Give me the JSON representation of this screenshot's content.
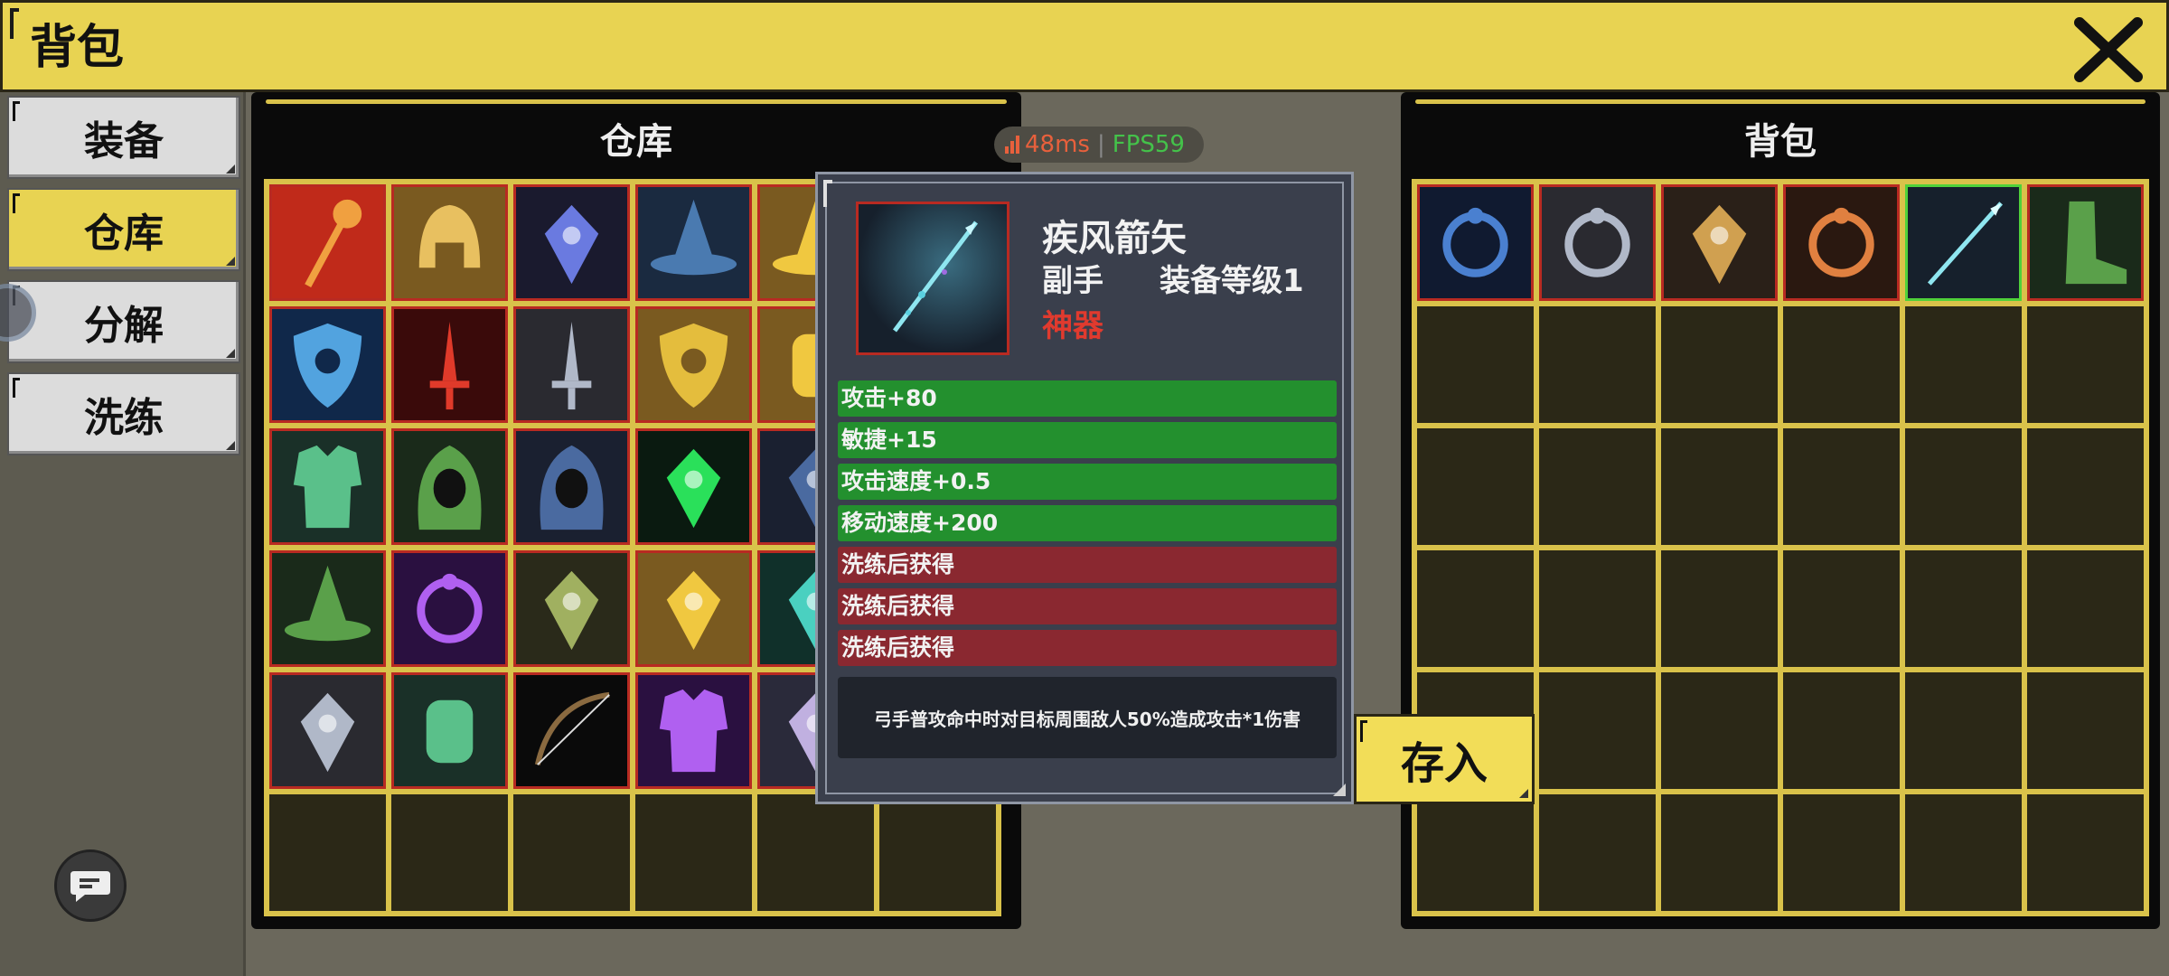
{
  "header": {
    "title": "背包"
  },
  "tabs": [
    {
      "label": "装备"
    },
    {
      "label": "仓库"
    },
    {
      "label": "分解"
    },
    {
      "label": "洗练"
    }
  ],
  "network": {
    "ping": "48ms",
    "fps": "FPS59"
  },
  "warehouse": {
    "title": "仓库"
  },
  "bag": {
    "title": "背包"
  },
  "tooltip": {
    "name": "疾风箭矢",
    "slot": "副手",
    "level": "装备等级1",
    "rarity": "神器",
    "stats": [
      {
        "text": "攻击+80",
        "kind": "green"
      },
      {
        "text": "敏捷+15",
        "kind": "green"
      },
      {
        "text": "攻击速度+0.5",
        "kind": "green"
      },
      {
        "text": "移动速度+200",
        "kind": "green"
      },
      {
        "text": "洗练后获得",
        "kind": "red"
      },
      {
        "text": "洗练后获得",
        "kind": "red"
      },
      {
        "text": "洗练后获得",
        "kind": "red"
      }
    ],
    "description": "弓手普攻命中时对目标周围敌人50%造成攻击*1伤害"
  },
  "deposit_button": {
    "label": "存入"
  },
  "colors": {
    "accent": "#e8d352",
    "rarity_red": "#e13a2e",
    "stat_green": "#23902e",
    "stat_red": "#8a2830",
    "select_green": "#4fd13a"
  },
  "warehouse_items": [
    "flame-staff-icon",
    "golden-helmet-icon",
    "star-pendant-icon",
    "wizard-hat-icon",
    "gold-hat-icon",
    "empty",
    "ice-shield-icon",
    "crimson-sword-icon",
    "silver-sword-icon",
    "gold-shield-icon",
    "gold-bracer-icon",
    "empty",
    "jade-armor-icon",
    "green-hood-icon",
    "blue-hood-icon",
    "emerald-necklace-icon",
    "blue-amulet-icon",
    "empty",
    "green-wizard-hat-icon",
    "purple-ring-icon",
    "leaf-necklace-icon",
    "gold-amulet-icon",
    "teal-gem-icon",
    "empty",
    "silver-amulet-icon",
    "jade-gauntlet-icon",
    "bow-icon",
    "purple-armor-icon",
    "crystal-icon",
    "empty",
    "empty",
    "empty",
    "empty",
    "empty",
    "empty",
    "empty"
  ],
  "bag_items": [
    "sapphire-ring-icon",
    "silver-ring-icon",
    "ornate-amulet-icon",
    "fire-ring-icon",
    "wind-arrow-icon",
    "green-boots-icon"
  ]
}
